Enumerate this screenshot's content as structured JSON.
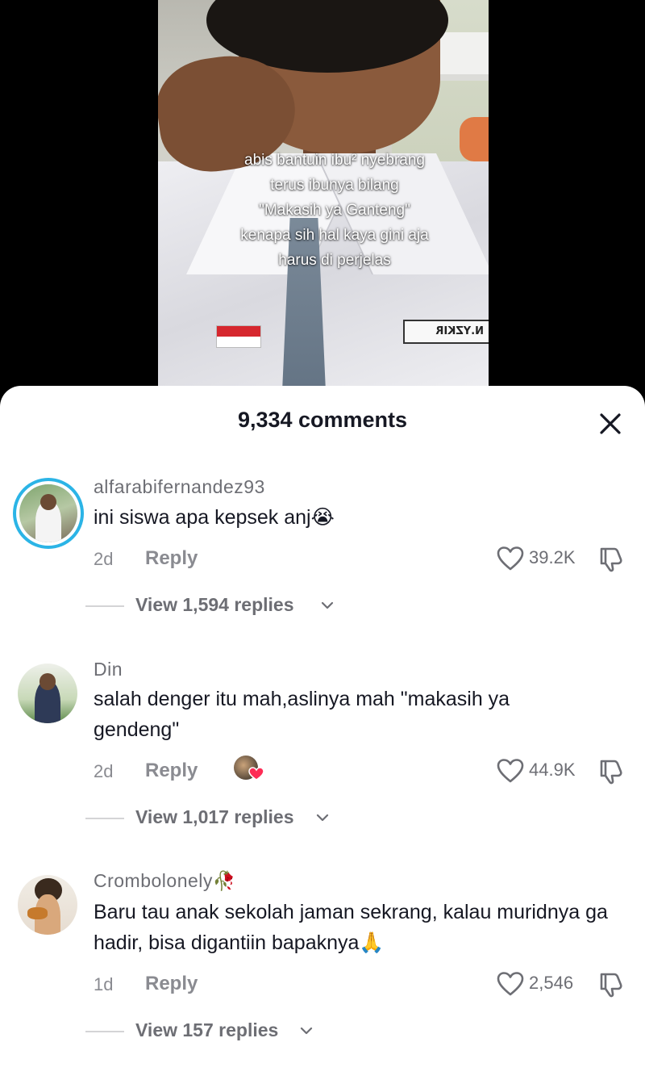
{
  "video": {
    "caption_lines": [
      "abis bantuin ibu² nyebrang",
      "terus ibunya bilang",
      "\"Makasih ya Ganteng\"",
      "kenapa sih hal kaya gini aja",
      "harus di perjelas"
    ],
    "name_tag": "N.YZKIR"
  },
  "sheet": {
    "title": "9,334 comments"
  },
  "comments": [
    {
      "username": "alfarabifernandez93",
      "text": "ini siswa apa kepsek anj😭",
      "time": "2d",
      "reply_label": "Reply",
      "likes": "39.2K",
      "view_replies": "View 1,594 replies"
    },
    {
      "username": "Din",
      "text": "salah denger itu mah,aslinya mah \"makasih ya gendeng\"",
      "time": "2d",
      "reply_label": "Reply",
      "likes": "44.9K",
      "view_replies": "View 1,017 replies"
    },
    {
      "username": "Crombolonely🥀",
      "text": "Baru tau anak sekolah jaman sekrang, kalau muridnya ga hadir, bisa digantiin bapaknya🙏",
      "time": "1d",
      "reply_label": "Reply",
      "likes": "2,546",
      "view_replies": "View 157 replies"
    }
  ],
  "colors": {
    "ring": "#2bb4e6",
    "text_primary": "#161823",
    "text_secondary": "#8a8b91"
  }
}
